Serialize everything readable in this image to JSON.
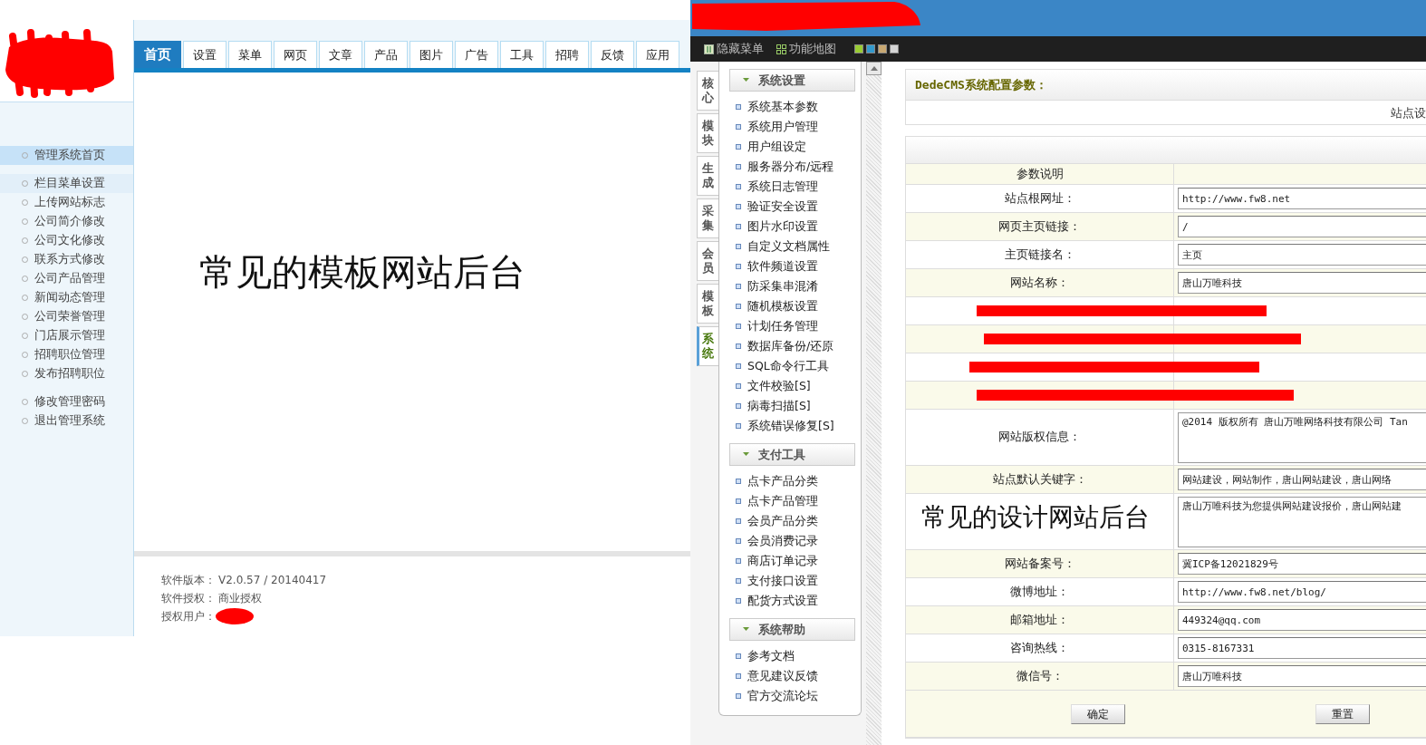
{
  "left_panel": {
    "tabs": [
      {
        "label": "首页",
        "selected": true
      },
      {
        "label": "设置",
        "selected": false
      },
      {
        "label": "菜单",
        "selected": false
      },
      {
        "label": "网页",
        "selected": false
      },
      {
        "label": "文章",
        "selected": false
      },
      {
        "label": "产品",
        "selected": false
      },
      {
        "label": "图片",
        "selected": false
      },
      {
        "label": "广告",
        "selected": false
      },
      {
        "label": "工具",
        "selected": false
      },
      {
        "label": "招聘",
        "selected": false
      },
      {
        "label": "反馈",
        "selected": false
      },
      {
        "label": "应用",
        "selected": false
      }
    ],
    "sidebar": {
      "groups": [
        {
          "items": [
            {
              "label": "管理系统首页",
              "selected": true,
              "highlighted": false
            }
          ]
        },
        {
          "items": [
            {
              "label": "栏目菜单设置",
              "selected": false,
              "highlighted": true
            },
            {
              "label": "上传网站标志",
              "selected": false,
              "highlighted": false
            },
            {
              "label": "公司简介修改",
              "selected": false,
              "highlighted": false
            },
            {
              "label": "公司文化修改",
              "selected": false,
              "highlighted": false
            },
            {
              "label": "联系方式修改",
              "selected": false,
              "highlighted": false
            },
            {
              "label": "公司产品管理",
              "selected": false,
              "highlighted": false
            },
            {
              "label": "新闻动态管理",
              "selected": false,
              "highlighted": false
            },
            {
              "label": "公司荣誉管理",
              "selected": false,
              "highlighted": false
            },
            {
              "label": "门店展示管理",
              "selected": false,
              "highlighted": false
            },
            {
              "label": "招聘职位管理",
              "selected": false,
              "highlighted": false
            },
            {
              "label": "发布招聘职位",
              "selected": false,
              "highlighted": false
            }
          ]
        },
        {
          "items": [
            {
              "label": "修改管理密码",
              "selected": false,
              "highlighted": false
            },
            {
              "label": "退出管理系统",
              "selected": false,
              "highlighted": false
            }
          ]
        }
      ]
    },
    "caption": "常见的模板网站后台",
    "footer": [
      {
        "label": "软件版本：",
        "value": "V2.0.57 / 20140417",
        "redacted": false
      },
      {
        "label": "软件授权：",
        "value": "商业授权",
        "redacted": false
      },
      {
        "label": "授权用户：",
        "redacted": true
      }
    ]
  },
  "right_panel": {
    "toolbar": [
      {
        "label": "隐藏菜单",
        "kind": "hide"
      },
      {
        "label": "功能地图",
        "kind": "map"
      }
    ],
    "swatches": [
      {
        "color": "#99cc33"
      },
      {
        "color": "#3399cc"
      },
      {
        "color": "#c8a872"
      },
      {
        "color": "#d4d4d4"
      }
    ],
    "side_tabs": [
      {
        "label": "核心",
        "selected": false
      },
      {
        "label": "模块",
        "selected": false
      },
      {
        "label": "生成",
        "selected": false
      },
      {
        "label": "采集",
        "selected": false
      },
      {
        "label": "会员",
        "selected": false
      },
      {
        "label": "模板",
        "selected": false
      },
      {
        "label": "系统",
        "selected": true
      }
    ],
    "menu": [
      {
        "title": "系统设置",
        "expanded": true,
        "items": [
          "系统基本参数",
          "系统用户管理",
          "用户组设定",
          "服务器分布/远程",
          "系统日志管理",
          "验证安全设置",
          "图片水印设置",
          "自定义文档属性",
          "软件频道设置",
          "防采集串混淆",
          "随机模板设置",
          "计划任务管理",
          "数据库备份/还原",
          "SQL命令行工具",
          "文件校验[S]",
          "病毒扫描[S]",
          "系统错误修复[S]"
        ]
      },
      {
        "title": "支付工具",
        "expanded": true,
        "items": [
          "点卡产品分类",
          "点卡产品管理",
          "会员产品分类",
          "会员消费记录",
          "商店订单记录",
          "支付接口设置",
          "配货方式设置"
        ]
      },
      {
        "title": "系统帮助",
        "expanded": true,
        "items": [
          "参考文档",
          "意见建议反馈",
          "官方交流论坛"
        ]
      }
    ],
    "form": {
      "title": "DedeCMS系统配置参数：",
      "tab": "站点设",
      "header": "参数说明",
      "rows": [
        {
          "kind": "input",
          "label": "站点根网址：",
          "value": "http://www.fw8.net"
        },
        {
          "kind": "input",
          "label": "网页主页链接：",
          "value": "/"
        },
        {
          "kind": "input",
          "label": "主页链接名：",
          "value": "主页"
        },
        {
          "kind": "input",
          "label": "网站名称：",
          "value": "唐山万唯科技"
        },
        {
          "kind": "redacted"
        },
        {
          "kind": "redacted"
        },
        {
          "kind": "redacted"
        },
        {
          "kind": "redacted"
        },
        {
          "kind": "textarea",
          "label": "网站版权信息：",
          "value": "@2014 版权所有 唐山万唯网络科技有限公司 Tan"
        },
        {
          "kind": "input",
          "label": "站点默认关键字：",
          "value": "网站建设，网站制作，唐山网站建设，唐山网络"
        },
        {
          "kind": "textarea",
          "value": "唐山万唯科技为您提供网站建设报价，唐山网站建"
        },
        {
          "kind": "input",
          "label": "网站备案号：",
          "value": "冀ICP备12021829号"
        },
        {
          "kind": "input",
          "label": "微博地址：",
          "value": "http://www.fw8.net/blog/"
        },
        {
          "kind": "input",
          "label": "邮箱地址：",
          "value": "449324@qq.com"
        },
        {
          "kind": "input",
          "label": "咨询热线：",
          "value": "0315-8167331"
        },
        {
          "kind": "input",
          "label": "微信号：",
          "value": "唐山万唯科技"
        }
      ],
      "buttons": [
        "确定",
        "重置"
      ]
    },
    "caption": "常见的设计网站后台"
  }
}
